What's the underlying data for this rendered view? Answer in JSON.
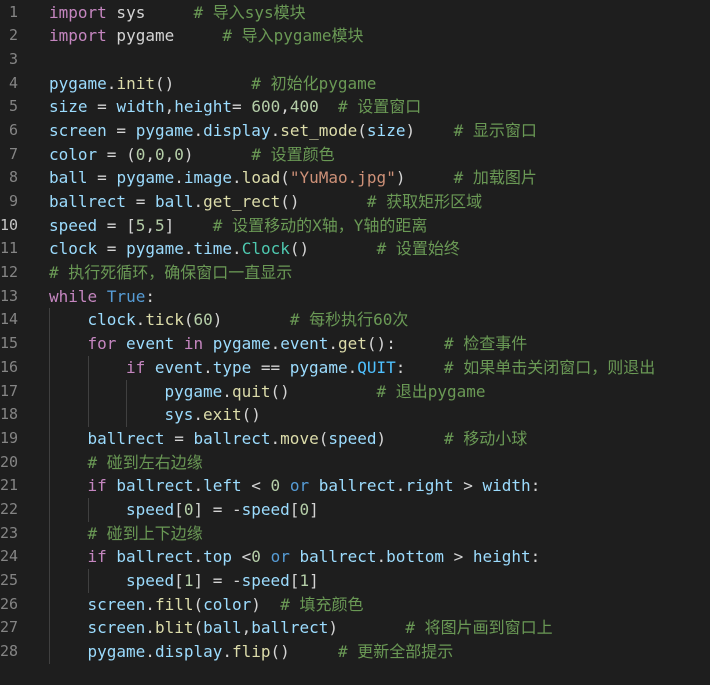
{
  "editor": {
    "theme": {
      "background": "#1e1e1e",
      "keyword": "#c586c0",
      "keyword_blue": "#569cd6",
      "function": "#dcdcaa",
      "variable": "#9cdcfe",
      "number": "#b5cea8",
      "string": "#ce9178",
      "comment": "#6a9955",
      "line_number": "#858585"
    },
    "active_line": 10,
    "lines": [
      {
        "n": "1",
        "indent": 0,
        "tokens": [
          {
            "t": "import",
            "c": "kw"
          },
          {
            "t": " sys     ",
            "c": "op"
          },
          {
            "t": "# 导入sys模块",
            "c": "cm"
          }
        ]
      },
      {
        "n": "2",
        "indent": 0,
        "tokens": [
          {
            "t": "import",
            "c": "kw"
          },
          {
            "t": " pygame     ",
            "c": "op"
          },
          {
            "t": "# 导入pygame模块",
            "c": "cm"
          }
        ]
      },
      {
        "n": "3",
        "indent": 0,
        "tokens": []
      },
      {
        "n": "4",
        "indent": 0,
        "tokens": [
          {
            "t": "pygame",
            "c": "var"
          },
          {
            "t": ".",
            "c": "op"
          },
          {
            "t": "init",
            "c": "fn"
          },
          {
            "t": "()        ",
            "c": "op"
          },
          {
            "t": "# 初始化pygame",
            "c": "cm"
          }
        ]
      },
      {
        "n": "5",
        "indent": 0,
        "tokens": [
          {
            "t": "size",
            "c": "var"
          },
          {
            "t": " = ",
            "c": "op"
          },
          {
            "t": "width",
            "c": "var"
          },
          {
            "t": ",",
            "c": "op"
          },
          {
            "t": "height",
            "c": "var"
          },
          {
            "t": "= ",
            "c": "op"
          },
          {
            "t": "600",
            "c": "num"
          },
          {
            "t": ",",
            "c": "op"
          },
          {
            "t": "400",
            "c": "num"
          },
          {
            "t": "  ",
            "c": "op"
          },
          {
            "t": "# 设置窗口",
            "c": "cm"
          }
        ]
      },
      {
        "n": "6",
        "indent": 0,
        "tokens": [
          {
            "t": "screen",
            "c": "var"
          },
          {
            "t": " = ",
            "c": "op"
          },
          {
            "t": "pygame",
            "c": "var"
          },
          {
            "t": ".",
            "c": "op"
          },
          {
            "t": "display",
            "c": "var"
          },
          {
            "t": ".",
            "c": "op"
          },
          {
            "t": "set_mode",
            "c": "fn"
          },
          {
            "t": "(",
            "c": "op"
          },
          {
            "t": "size",
            "c": "var"
          },
          {
            "t": ")    ",
            "c": "op"
          },
          {
            "t": "# 显示窗口",
            "c": "cm"
          }
        ]
      },
      {
        "n": "7",
        "indent": 0,
        "tokens": [
          {
            "t": "color",
            "c": "var"
          },
          {
            "t": " = (",
            "c": "op"
          },
          {
            "t": "0",
            "c": "num"
          },
          {
            "t": ",",
            "c": "op"
          },
          {
            "t": "0",
            "c": "num"
          },
          {
            "t": ",",
            "c": "op"
          },
          {
            "t": "0",
            "c": "num"
          },
          {
            "t": ")      ",
            "c": "op"
          },
          {
            "t": "# 设置颜色",
            "c": "cm"
          }
        ]
      },
      {
        "n": "8",
        "indent": 0,
        "tokens": [
          {
            "t": "ball",
            "c": "var"
          },
          {
            "t": " = ",
            "c": "op"
          },
          {
            "t": "pygame",
            "c": "var"
          },
          {
            "t": ".",
            "c": "op"
          },
          {
            "t": "image",
            "c": "var"
          },
          {
            "t": ".",
            "c": "op"
          },
          {
            "t": "load",
            "c": "fn"
          },
          {
            "t": "(",
            "c": "op"
          },
          {
            "t": "\"YuMao.jpg\"",
            "c": "str"
          },
          {
            "t": ")     ",
            "c": "op"
          },
          {
            "t": "# 加载图片",
            "c": "cm"
          }
        ]
      },
      {
        "n": "9",
        "indent": 0,
        "tokens": [
          {
            "t": "ballrect",
            "c": "var"
          },
          {
            "t": " = ",
            "c": "op"
          },
          {
            "t": "ball",
            "c": "var"
          },
          {
            "t": ".",
            "c": "op"
          },
          {
            "t": "get_rect",
            "c": "fn"
          },
          {
            "t": "()       ",
            "c": "op"
          },
          {
            "t": "# 获取矩形区域",
            "c": "cm"
          }
        ]
      },
      {
        "n": "10",
        "indent": 0,
        "tokens": [
          {
            "t": "speed",
            "c": "var"
          },
          {
            "t": " = [",
            "c": "op"
          },
          {
            "t": "5",
            "c": "num"
          },
          {
            "t": ",",
            "c": "op"
          },
          {
            "t": "5",
            "c": "num"
          },
          {
            "t": "]    ",
            "c": "op"
          },
          {
            "t": "# 设置移动的X轴，Y轴的距离",
            "c": "cm"
          }
        ]
      },
      {
        "n": "11",
        "indent": 0,
        "tokens": [
          {
            "t": "clock",
            "c": "var"
          },
          {
            "t": " = ",
            "c": "op"
          },
          {
            "t": "pygame",
            "c": "var"
          },
          {
            "t": ".",
            "c": "op"
          },
          {
            "t": "time",
            "c": "var"
          },
          {
            "t": ".",
            "c": "op"
          },
          {
            "t": "Clock",
            "c": "cls"
          },
          {
            "t": "()       ",
            "c": "op"
          },
          {
            "t": "# 设置始终",
            "c": "cm"
          }
        ]
      },
      {
        "n": "12",
        "indent": 0,
        "tokens": [
          {
            "t": "# 执行死循环，确保窗口一直显示",
            "c": "cm"
          }
        ]
      },
      {
        "n": "13",
        "indent": 0,
        "tokens": [
          {
            "t": "while",
            "c": "kw"
          },
          {
            "t": " ",
            "c": "op"
          },
          {
            "t": "True",
            "c": "kw2"
          },
          {
            "t": ":",
            "c": "op"
          }
        ]
      },
      {
        "n": "14",
        "indent": 1,
        "tokens": [
          {
            "t": "clock",
            "c": "var"
          },
          {
            "t": ".",
            "c": "op"
          },
          {
            "t": "tick",
            "c": "fn"
          },
          {
            "t": "(",
            "c": "op"
          },
          {
            "t": "60",
            "c": "num"
          },
          {
            "t": ")       ",
            "c": "op"
          },
          {
            "t": "# 每秒执行60次",
            "c": "cm"
          }
        ]
      },
      {
        "n": "15",
        "indent": 1,
        "tokens": [
          {
            "t": "for",
            "c": "kw"
          },
          {
            "t": " ",
            "c": "op"
          },
          {
            "t": "event",
            "c": "var"
          },
          {
            "t": " ",
            "c": "op"
          },
          {
            "t": "in",
            "c": "kw"
          },
          {
            "t": " ",
            "c": "op"
          },
          {
            "t": "pygame",
            "c": "var"
          },
          {
            "t": ".",
            "c": "op"
          },
          {
            "t": "event",
            "c": "var"
          },
          {
            "t": ".",
            "c": "op"
          },
          {
            "t": "get",
            "c": "fn"
          },
          {
            "t": "():     ",
            "c": "op"
          },
          {
            "t": "# 检查事件",
            "c": "cm"
          }
        ]
      },
      {
        "n": "16",
        "indent": 2,
        "tokens": [
          {
            "t": "if",
            "c": "kw"
          },
          {
            "t": " ",
            "c": "op"
          },
          {
            "t": "event",
            "c": "var"
          },
          {
            "t": ".",
            "c": "op"
          },
          {
            "t": "type",
            "c": "var"
          },
          {
            "t": " == ",
            "c": "op"
          },
          {
            "t": "pygame",
            "c": "var"
          },
          {
            "t": ".",
            "c": "op"
          },
          {
            "t": "QUIT",
            "c": "const"
          },
          {
            "t": ":    ",
            "c": "op"
          },
          {
            "t": "# 如果单击关闭窗口，则退出",
            "c": "cm"
          }
        ]
      },
      {
        "n": "17",
        "indent": 3,
        "tokens": [
          {
            "t": "pygame",
            "c": "var"
          },
          {
            "t": ".",
            "c": "op"
          },
          {
            "t": "quit",
            "c": "fn"
          },
          {
            "t": "()         ",
            "c": "op"
          },
          {
            "t": "# 退出pygame",
            "c": "cm"
          }
        ]
      },
      {
        "n": "18",
        "indent": 3,
        "tokens": [
          {
            "t": "sys",
            "c": "var"
          },
          {
            "t": ".",
            "c": "op"
          },
          {
            "t": "exit",
            "c": "fn"
          },
          {
            "t": "()",
            "c": "op"
          }
        ]
      },
      {
        "n": "19",
        "indent": 1,
        "tokens": [
          {
            "t": "ballrect",
            "c": "var"
          },
          {
            "t": " = ",
            "c": "op"
          },
          {
            "t": "ballrect",
            "c": "var"
          },
          {
            "t": ".",
            "c": "op"
          },
          {
            "t": "move",
            "c": "fn"
          },
          {
            "t": "(",
            "c": "op"
          },
          {
            "t": "speed",
            "c": "var"
          },
          {
            "t": ")      ",
            "c": "op"
          },
          {
            "t": "# 移动小球",
            "c": "cm"
          }
        ]
      },
      {
        "n": "20",
        "indent": 1,
        "tokens": [
          {
            "t": "# 碰到左右边缘",
            "c": "cm"
          }
        ]
      },
      {
        "n": "21",
        "indent": 1,
        "tokens": [
          {
            "t": "if",
            "c": "kw"
          },
          {
            "t": " ",
            "c": "op"
          },
          {
            "t": "ballrect",
            "c": "var"
          },
          {
            "t": ".",
            "c": "op"
          },
          {
            "t": "left",
            "c": "var"
          },
          {
            "t": " < ",
            "c": "op"
          },
          {
            "t": "0",
            "c": "num"
          },
          {
            "t": " ",
            "c": "op"
          },
          {
            "t": "or",
            "c": "kw2"
          },
          {
            "t": " ",
            "c": "op"
          },
          {
            "t": "ballrect",
            "c": "var"
          },
          {
            "t": ".",
            "c": "op"
          },
          {
            "t": "right",
            "c": "var"
          },
          {
            "t": " > ",
            "c": "op"
          },
          {
            "t": "width",
            "c": "var"
          },
          {
            "t": ":",
            "c": "op"
          }
        ]
      },
      {
        "n": "22",
        "indent": 2,
        "tokens": [
          {
            "t": "speed",
            "c": "var"
          },
          {
            "t": "[",
            "c": "op"
          },
          {
            "t": "0",
            "c": "num"
          },
          {
            "t": "] = -",
            "c": "op"
          },
          {
            "t": "speed",
            "c": "var"
          },
          {
            "t": "[",
            "c": "op"
          },
          {
            "t": "0",
            "c": "num"
          },
          {
            "t": "]",
            "c": "op"
          }
        ]
      },
      {
        "n": "23",
        "indent": 1,
        "tokens": [
          {
            "t": "# 碰到上下边缘",
            "c": "cm"
          }
        ]
      },
      {
        "n": "24",
        "indent": 1,
        "tokens": [
          {
            "t": "if",
            "c": "kw"
          },
          {
            "t": " ",
            "c": "op"
          },
          {
            "t": "ballrect",
            "c": "var"
          },
          {
            "t": ".",
            "c": "op"
          },
          {
            "t": "top",
            "c": "var"
          },
          {
            "t": " <",
            "c": "op"
          },
          {
            "t": "0",
            "c": "num"
          },
          {
            "t": " ",
            "c": "op"
          },
          {
            "t": "or",
            "c": "kw2"
          },
          {
            "t": " ",
            "c": "op"
          },
          {
            "t": "ballrect",
            "c": "var"
          },
          {
            "t": ".",
            "c": "op"
          },
          {
            "t": "bottom",
            "c": "var"
          },
          {
            "t": " > ",
            "c": "op"
          },
          {
            "t": "height",
            "c": "var"
          },
          {
            "t": ":",
            "c": "op"
          }
        ]
      },
      {
        "n": "25",
        "indent": 2,
        "tokens": [
          {
            "t": "speed",
            "c": "var"
          },
          {
            "t": "[",
            "c": "op"
          },
          {
            "t": "1",
            "c": "num"
          },
          {
            "t": "] = -",
            "c": "op"
          },
          {
            "t": "speed",
            "c": "var"
          },
          {
            "t": "[",
            "c": "op"
          },
          {
            "t": "1",
            "c": "num"
          },
          {
            "t": "]",
            "c": "op"
          }
        ]
      },
      {
        "n": "26",
        "indent": 1,
        "tokens": [
          {
            "t": "screen",
            "c": "var"
          },
          {
            "t": ".",
            "c": "op"
          },
          {
            "t": "fill",
            "c": "fn"
          },
          {
            "t": "(",
            "c": "op"
          },
          {
            "t": "color",
            "c": "var"
          },
          {
            "t": ")  ",
            "c": "op"
          },
          {
            "t": "# 填充颜色",
            "c": "cm"
          }
        ]
      },
      {
        "n": "27",
        "indent": 1,
        "tokens": [
          {
            "t": "screen",
            "c": "var"
          },
          {
            "t": ".",
            "c": "op"
          },
          {
            "t": "blit",
            "c": "fn"
          },
          {
            "t": "(",
            "c": "op"
          },
          {
            "t": "ball",
            "c": "var"
          },
          {
            "t": ",",
            "c": "op"
          },
          {
            "t": "ballrect",
            "c": "var"
          },
          {
            "t": ")       ",
            "c": "op"
          },
          {
            "t": "# 将图片画到窗口上",
            "c": "cm"
          }
        ]
      },
      {
        "n": "28",
        "indent": 1,
        "tokens": [
          {
            "t": "pygame",
            "c": "var"
          },
          {
            "t": ".",
            "c": "op"
          },
          {
            "t": "display",
            "c": "var"
          },
          {
            "t": ".",
            "c": "op"
          },
          {
            "t": "flip",
            "c": "fn"
          },
          {
            "t": "()     ",
            "c": "op"
          },
          {
            "t": "# 更新全部提示",
            "c": "cm"
          }
        ]
      }
    ]
  }
}
